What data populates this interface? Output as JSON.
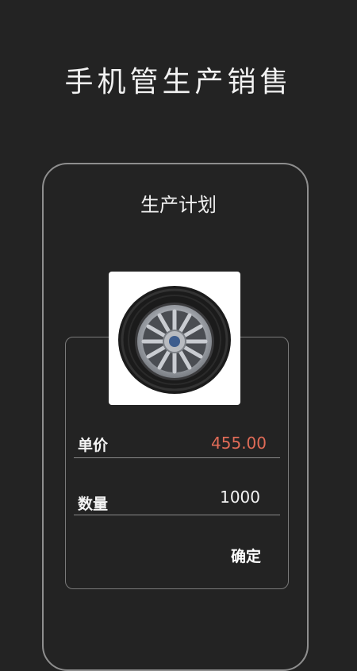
{
  "header": {
    "title": "手机管生产销售"
  },
  "screen": {
    "title": "生产计划"
  },
  "product": {
    "image_icon": "tire-wheel-image"
  },
  "form": {
    "price_label": "单价",
    "price_value": "455.00",
    "quantity_label": "数量",
    "quantity_value": "1000",
    "confirm_label": "确定"
  },
  "colors": {
    "price": "#e06b57",
    "background": "#232323"
  }
}
